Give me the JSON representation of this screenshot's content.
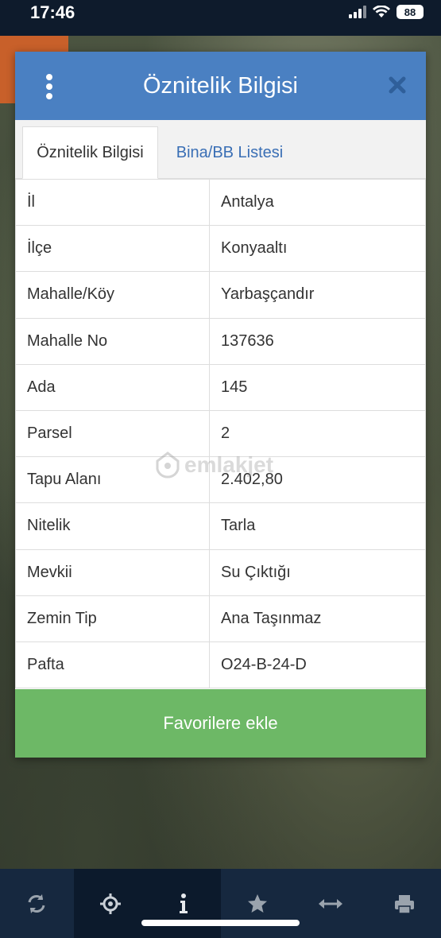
{
  "status_bar": {
    "time": "17:46",
    "battery": "88"
  },
  "dialog": {
    "title": "Öznitelik Bilgisi",
    "tabs": [
      {
        "label": "Öznitelik Bilgisi",
        "active": true
      },
      {
        "label": "Bina/BB Listesi",
        "active": false
      }
    ],
    "rows": [
      {
        "label": "İl",
        "value": "Antalya"
      },
      {
        "label": "İlçe",
        "value": "Konyaaltı"
      },
      {
        "label": "Mahalle/Köy",
        "value": "Yarbaşçandır"
      },
      {
        "label": "Mahalle No",
        "value": "137636"
      },
      {
        "label": "Ada",
        "value": "145"
      },
      {
        "label": "Parsel",
        "value": "2"
      },
      {
        "label": "Tapu Alanı",
        "value": "2.402,80"
      },
      {
        "label": "Nitelik",
        "value": "Tarla"
      },
      {
        "label": "Mevkii",
        "value": "Su Çıktığı"
      },
      {
        "label": "Zemin Tip",
        "value": "Ana Taşınmaz"
      },
      {
        "label": "Pafta",
        "value": "O24-B-24-D"
      }
    ],
    "favorite_button": "Favorilere ekle"
  },
  "watermark": "emlakjet",
  "bottom_bar": {
    "items": [
      {
        "icon": "refresh-icon",
        "active": false
      },
      {
        "icon": "locate-icon",
        "active": true
      },
      {
        "icon": "info-icon",
        "active": true
      },
      {
        "icon": "star-icon",
        "active": false
      },
      {
        "icon": "measure-icon",
        "active": false
      },
      {
        "icon": "print-icon",
        "active": false
      }
    ]
  },
  "colors": {
    "header": "#4a80c2",
    "favorite_button": "#6db866",
    "bottom_bar": "#16283f",
    "tab_inactive_text": "#3a6fb5"
  }
}
